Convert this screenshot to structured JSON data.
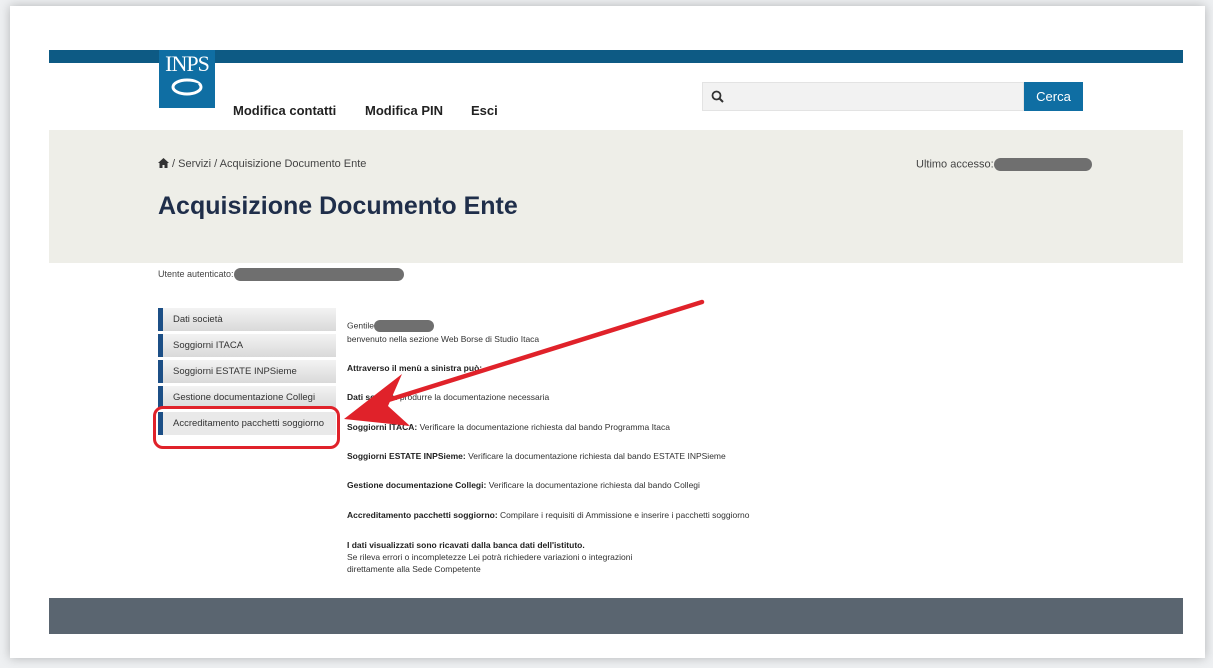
{
  "logo": {
    "text": "INPS"
  },
  "nav": {
    "modifica_contatti": "Modifica contatti",
    "modifica_pin": "Modifica PIN",
    "esci": "Esci"
  },
  "search": {
    "placeholder": "",
    "button": "Cerca"
  },
  "breadcrumb": {
    "text": "/ Servizi / Acquisizione Documento Ente"
  },
  "last_access": {
    "label": "Ultimo accesso:"
  },
  "page_title": "Acquisizione Documento Ente",
  "user": {
    "label": "Utente autenticato:"
  },
  "menu": {
    "items": [
      "Dati società",
      "Soggiorni ITACA",
      "Soggiorni ESTATE INPSieme",
      "Gestione documentazione Collegi",
      "Accreditamento pacchetti soggiorno"
    ]
  },
  "content": {
    "greeting": "Gentile",
    "welcome": "benvenuto nella sezione Web Borse di Studio Itaca",
    "intro": "Attraverso il menù a sinistra può:",
    "dati_label": "Dati società:",
    "dati_text": "produrre la documentazione necessaria",
    "itaca_label": "Soggiorni ITACA:",
    "itaca_text": "Verificare la documentazione richiesta dal bando Programma Itaca",
    "estate_label": "Soggiorni ESTATE INPSieme:",
    "estate_text": "Verificare la documentazione richiesta dal bando ESTATE INPSieme",
    "collegi_label": "Gestione documentazione Collegi:",
    "collegi_text": "Verificare la documentazione richiesta dal bando Collegi",
    "accred_label": "Accreditamento pacchetti soggiorno:",
    "accred_text": "Compilare i requisiti di Ammissione e inserire i pacchetti soggiorno",
    "note_title": "I dati visualizzati sono ricavati dalla banca dati dell'istituto.",
    "note_line1": "Se rileva errori o incompletezze Lei potrà richiedere variazioni o integrazioni",
    "note_line2": "direttamente alla Sede Competente"
  },
  "colors": {
    "brand_blue": "#0f6ea3",
    "annotation_red": "#e0222a",
    "band": "#eeeee8",
    "footer": "#5a6570"
  }
}
